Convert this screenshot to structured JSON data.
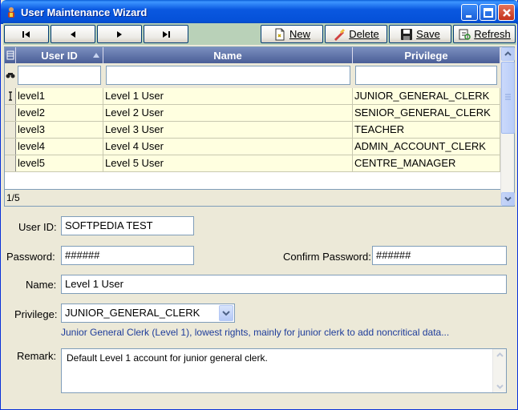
{
  "window": {
    "title": "User Maintenance Wizard"
  },
  "toolbar": {
    "first_icon": "skip-first-icon",
    "prev_icon": "previous-icon",
    "next_icon": "next-icon",
    "last_icon": "skip-last-icon",
    "new_label": "New",
    "delete_label": "Delete",
    "save_label": "Save",
    "refresh_label": "Refresh"
  },
  "grid": {
    "columns": [
      "User ID",
      "Name",
      "Privilege"
    ],
    "rows": [
      {
        "user_id": "level1",
        "name": "Level 1 User",
        "privilege": "JUNIOR_GENERAL_CLERK"
      },
      {
        "user_id": "level2",
        "name": "Level 2 User",
        "privilege": "SENIOR_GENERAL_CLERK"
      },
      {
        "user_id": "level3",
        "name": "Level 3 User",
        "privilege": "TEACHER"
      },
      {
        "user_id": "level4",
        "name": "Level 4 User",
        "privilege": "ADMIN_ACCOUNT_CLERK"
      },
      {
        "user_id": "level5",
        "name": "Level 5 User",
        "privilege": "CENTRE_MANAGER"
      }
    ],
    "record_position": "1/5"
  },
  "form": {
    "user_id_label": "User ID:",
    "user_id_value": "SOFTPEDIA TEST",
    "password_label": "Password:",
    "password_value": "######",
    "confirm_label": "Confirm Password:",
    "confirm_value": "######",
    "name_label": "Name:",
    "name_value": "Level 1 User",
    "privilege_label": "Privilege:",
    "privilege_value": "JUNIOR_GENERAL_CLERK",
    "privilege_description": "Junior General Clerk (Level 1), lowest rights, mainly for junior clerk to add noncritical data...",
    "remark_label": "Remark:",
    "remark_value": "Default Level 1 account for junior general clerk."
  },
  "colors": {
    "title_bar": "#0551d8",
    "grid_header": "#5a6ea5",
    "row_background": "#ffffe0",
    "description_text": "#1e3c9a"
  }
}
